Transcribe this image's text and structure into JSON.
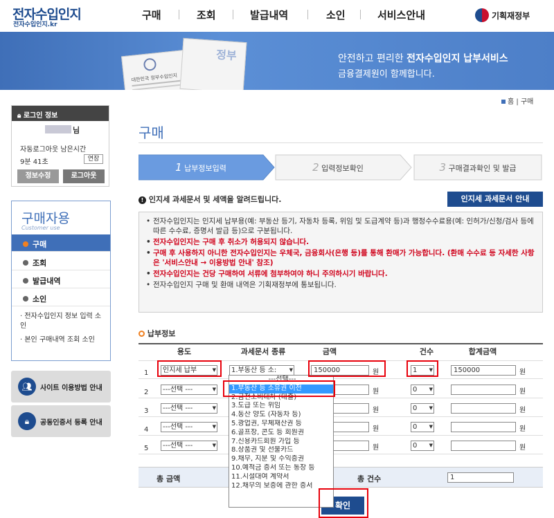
{
  "header": {
    "logo_title": "전자수입인지",
    "logo_sub": "전자수입인지.kr",
    "nav": [
      "구매",
      "조회",
      "발급내역",
      "소인",
      "서비스안내"
    ],
    "gov_label": "기획재정부"
  },
  "banner": {
    "line1_prefix": "안전하고 편리한 ",
    "line1_bold": "전자수입인지 납부서비스",
    "line2": "금융결제원이 함께합니다.",
    "doc_title": "대한민국 정부수입인지",
    "stamp_text": "정부"
  },
  "breadcrumb": {
    "home": "홈",
    "current": "구매"
  },
  "login": {
    "title": "로그인 정보",
    "user_suffix": "님",
    "autologout_label": "자동로그아웃 남은시간",
    "time": "9분 41초",
    "extend": "연장",
    "edit": "정보수정",
    "logout": "로그아웃"
  },
  "menu": {
    "title": "구매자용",
    "subtitle": "Customer use",
    "items": [
      "구매",
      "조회",
      "발급내역",
      "소인"
    ],
    "links": [
      "전자수입인지 정보 입력 소인",
      "본인 구매내역 조회 소인"
    ]
  },
  "side_buttons": [
    "사이트 이용방법 안내",
    "공동인증서 등록 안내"
  ],
  "page_title": "구매",
  "steps": [
    {
      "num": "1",
      "label": "납부정보입력"
    },
    {
      "num": "2",
      "label": "입력정보확인"
    },
    {
      "num": "3",
      "label": "구매결과확인 및 발급"
    }
  ],
  "notice": {
    "heading": "인지세 과세문서 및 세액을 알려드립니다.",
    "guide_button": "인지세 과세문서 안내",
    "items": [
      {
        "text": "전자수입인지는 인지세 납부용(예: 부동산 등기, 자동차 등록, 위임 및 도급계약 등)과 행정수수료용(예: 인허가/신청/검사 등에 따른 수수료, 증명서 발급 등)으로 구분됩니다.",
        "red": false
      },
      {
        "text": "전자수입인지는 구매 후 취소가 허용되지 않습니다.",
        "red": true
      },
      {
        "text": "구매 후 사용하지 아니한 전자수입인지는 우체국, 금융회사(은행 등)를 통해 환매가 가능합니다. (환매 수수료 등 자세한 사항은 '서비스안내 → 이용방법 안내' 참조)",
        "red": true
      },
      {
        "text": "전자수입인지는 건당 구매하여 서류에 첨부하여야 하니 주의하시기 바랍니다.",
        "red": true
      },
      {
        "text": "전자수입인지 구매 및 환매 내역은 기획재정부에 통보됩니다.",
        "red": false
      }
    ]
  },
  "payment": {
    "title": "납부정보",
    "headers": [
      "용도",
      "과세문서 종류",
      "금액",
      "건수",
      "합계금액"
    ],
    "won": "원",
    "rows": [
      {
        "no": "1",
        "usage": "인지세 납부",
        "doc": "1.부동산 등 소:",
        "amount": "150000",
        "count": "1",
        "total": "150000"
      },
      {
        "no": "2",
        "usage": "---선택 ---",
        "doc": "",
        "amount": "",
        "count": "0",
        "total": ""
      },
      {
        "no": "3",
        "usage": "---선택 ---",
        "doc": "",
        "amount": "",
        "count": "0",
        "total": ""
      },
      {
        "no": "4",
        "usage": "---선택 ---",
        "doc": "",
        "amount": "",
        "count": "0",
        "total": ""
      },
      {
        "no": "5",
        "usage": "---선택 ---",
        "doc": "",
        "amount": "",
        "count": "0",
        "total": ""
      }
    ],
    "total_amount_label": "총 금액",
    "total_count_label": "총 건수",
    "total_count": "1",
    "confirm": "확인"
  },
  "dropdown": {
    "options": [
      "---선택---",
      "1.부동산 등 소유권 이전",
      "2.금전소비대차 (대출)",
      "3.도급 또는 위임",
      "4.동산 양도 (자동차 등)",
      "5.광업권, 무체재산권 등",
      "6.골프장, 콘도 등 회원권",
      "7.신용카드회원 가입 등",
      "8.상품권 및 선불카드",
      "9.채무, 지분 및 수익증권",
      "10.예적금 증서 또는 통장 등",
      "11.시설대여 계약서",
      "12.채무의 보증에 관한 증서"
    ],
    "selected_index": 1
  },
  "colors": {
    "accent": "#3f6fb8",
    "highlight": "#e8000b",
    "notice_red": "#d0021b"
  }
}
